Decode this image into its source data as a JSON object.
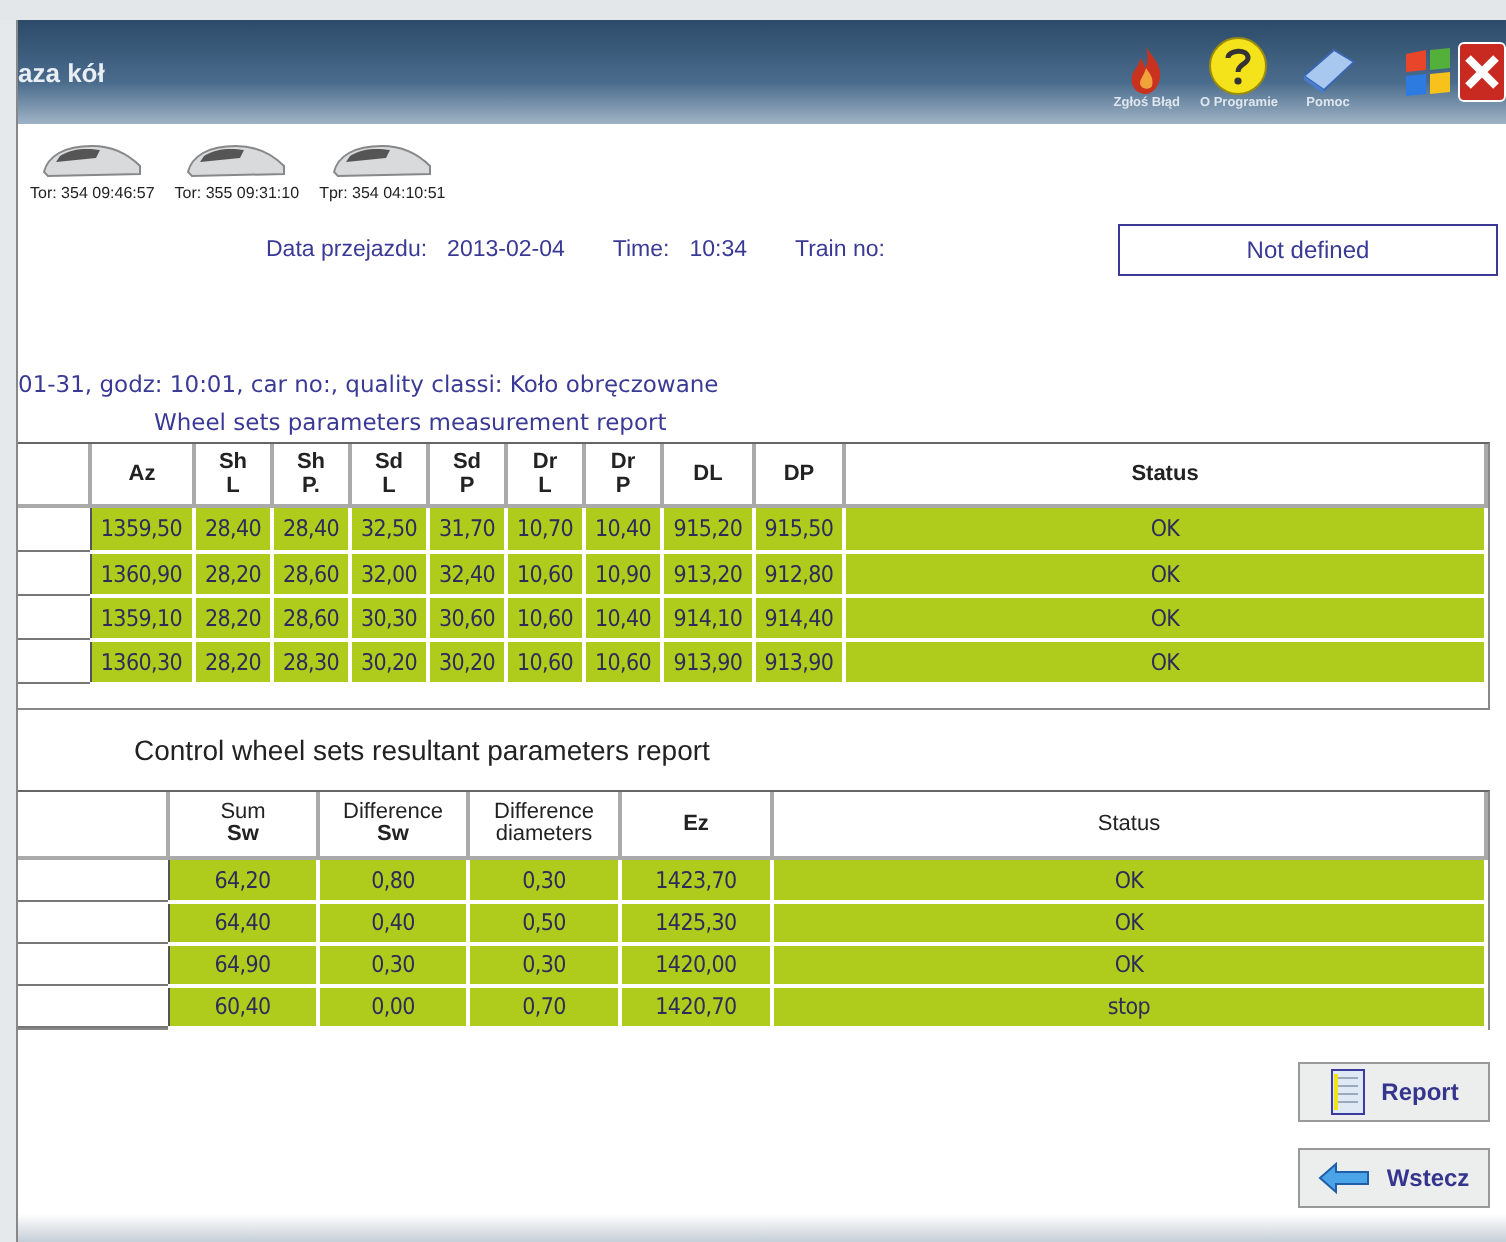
{
  "window": {
    "title": "aza kół"
  },
  "toolbar": [
    {
      "kind": "flame",
      "label": "Zgłoś Błąd"
    },
    {
      "kind": "help",
      "label": "O Programie"
    },
    {
      "kind": "book",
      "label": "Pomoc"
    }
  ],
  "trains": [
    {
      "label": "Tor: 354 09:46:57"
    },
    {
      "label": "Tor: 355 09:31:10"
    },
    {
      "label": "Tpr: 354 04:10:51"
    }
  ],
  "info": {
    "date_label": "Data przejazdu:",
    "date": "2013-02-04",
    "time_label": "Time:",
    "time": "10:34",
    "train_label": "Train no:",
    "train_value": "Not defined"
  },
  "subtitle": "01-31, godz: 10:01, car no:, quality classi: Koło obręczowane",
  "measurement": {
    "title": "Wheel sets parameters measurement report",
    "columns": [
      {
        "top": "Az"
      },
      {
        "top": "Sh",
        "bottom": "L"
      },
      {
        "top": "Sh",
        "bottom": "P."
      },
      {
        "top": "Sd",
        "bottom": "L"
      },
      {
        "top": "Sd",
        "bottom": "P"
      },
      {
        "top": "Dr",
        "bottom": "L"
      },
      {
        "top": "Dr",
        "bottom": "P"
      },
      {
        "top": "DL"
      },
      {
        "top": "DP"
      },
      {
        "top": "Status"
      }
    ],
    "rows": [
      [
        "1359,50",
        "28,40",
        "28,40",
        "32,50",
        "31,70",
        "10,70",
        "10,40",
        "915,20",
        "915,50",
        "OK"
      ],
      [
        "1360,90",
        "28,20",
        "28,60",
        "32,00",
        "32,40",
        "10,60",
        "10,90",
        "913,20",
        "912,80",
        "OK"
      ],
      [
        "1359,10",
        "28,20",
        "28,60",
        "30,30",
        "30,60",
        "10,60",
        "10,40",
        "914,10",
        "914,40",
        "OK"
      ],
      [
        "1360,30",
        "28,20",
        "28,30",
        "30,20",
        "30,20",
        "10,60",
        "10,60",
        "913,90",
        "913,90",
        "OK"
      ]
    ]
  },
  "control": {
    "title": "Control wheel sets resultant parameters report",
    "columns": [
      {
        "top": "Sum",
        "bottom": "Sw"
      },
      {
        "top": "Difference",
        "bottom": "Sw"
      },
      {
        "top": "Difference",
        "bottom": "diameters"
      },
      {
        "top": "Ez"
      },
      {
        "top": "Status"
      }
    ],
    "rows": [
      [
        "64,20",
        "0,80",
        "0,30",
        "1423,70",
        "OK"
      ],
      [
        "64,40",
        "0,40",
        "0,50",
        "1425,30",
        "OK"
      ],
      [
        "64,90",
        "0,30",
        "0,30",
        "1420,00",
        "OK"
      ],
      [
        "60,40",
        "0,00",
        "0,70",
        "1420,70",
        "stop"
      ]
    ]
  },
  "buttons": [
    {
      "kind": "report",
      "label": "Report"
    },
    {
      "kind": "back",
      "label": "Wstecz"
    }
  ]
}
